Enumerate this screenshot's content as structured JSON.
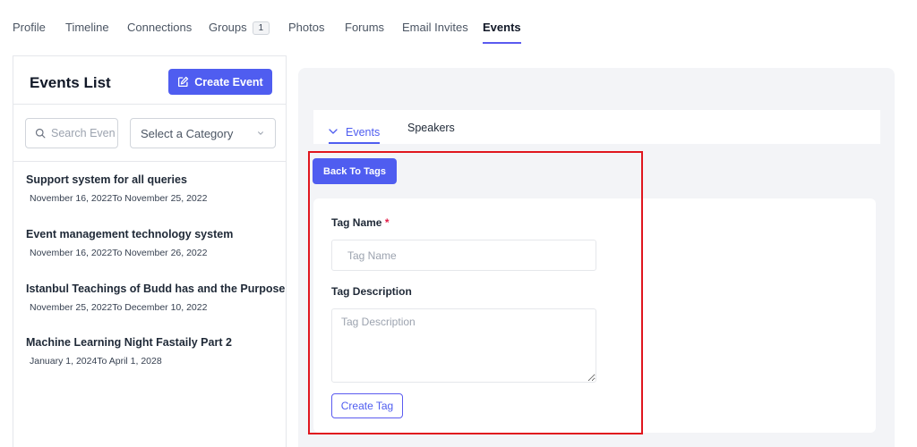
{
  "nav": {
    "tabs": [
      {
        "label": "Profile"
      },
      {
        "label": "Timeline"
      },
      {
        "label": "Connections"
      },
      {
        "label": "Groups",
        "badge": "1"
      },
      {
        "label": "Photos"
      },
      {
        "label": "Forums"
      },
      {
        "label": "Email Invites"
      },
      {
        "label": "Events"
      }
    ],
    "active_tab": "Events"
  },
  "events_list": {
    "title": "Events List",
    "create_button": "Create Event",
    "search_placeholder": "Search Events",
    "category_select": "Select a Category",
    "items": [
      {
        "title": "Support system for all queries",
        "date": "November 16, 2022To November 25, 2022"
      },
      {
        "title": "Event management technology system",
        "date": "November 16, 2022To November 26, 2022"
      },
      {
        "title": "Istanbul Teachings of Budd has and the Purpose",
        "date": "November 25, 2022To December 10, 2022"
      },
      {
        "title": "Machine Learning Night Fastaily Part 2",
        "date": "January 1, 2024To April 1, 2028"
      }
    ]
  },
  "detail": {
    "tabs": {
      "events": "Events",
      "speakers": "Speakers"
    },
    "back_button": "Back To Tags",
    "form": {
      "tag_name_label": "Tag Name",
      "required_mark": "*",
      "tag_name_placeholder": "Tag Name",
      "tag_name_value": "",
      "tag_description_label": "Tag Description",
      "tag_description_placeholder": "Tag Description",
      "tag_description_value": "",
      "submit_button": "Create Tag"
    }
  },
  "colors": {
    "accent": "#4f5df0",
    "highlight": "#e0161e",
    "required": "#e11d48",
    "panel_bg": "#f3f4f7"
  },
  "icons": {
    "create_event": "edit-square-icon",
    "search": "search-icon",
    "select": "chevron-down-icon",
    "events_tab": "chevron-down-icon"
  }
}
